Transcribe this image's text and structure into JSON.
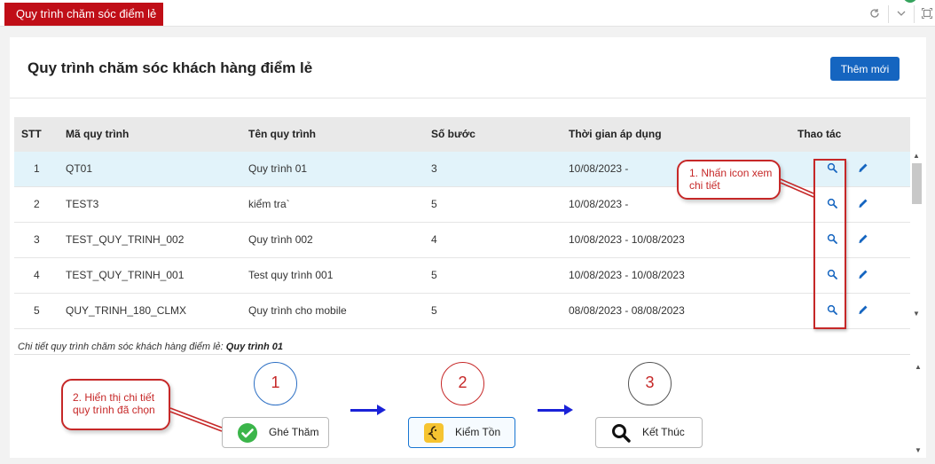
{
  "window": {
    "tab_title": "Quy trình chăm sóc điểm lẻ",
    "controls": [
      "refresh-icon",
      "chevron-down-icon",
      "maximize-icon"
    ]
  },
  "header": {
    "title": "Quy trình chăm sóc khách hàng điểm lẻ",
    "add_button": "Thêm mới"
  },
  "table": {
    "columns": [
      "STT",
      "Mã quy trình",
      "Tên quy trình",
      "Số bước",
      "Thời gian áp dụng",
      "Thao tác"
    ],
    "rows": [
      {
        "stt": "1",
        "ma": "QT01",
        "ten": "Quy trình 01",
        "so_buoc": "3",
        "thoi_gian": "10/08/2023 -",
        "selected": true
      },
      {
        "stt": "2",
        "ma": "TEST3",
        "ten": "kiểm tra`",
        "so_buoc": "5",
        "thoi_gian": "10/08/2023 -",
        "selected": false
      },
      {
        "stt": "3",
        "ma": "TEST_QUY_TRINH_002",
        "ten": "Quy trình 002",
        "so_buoc": "4",
        "thoi_gian": "10/08/2023 - 10/08/2023",
        "selected": false
      },
      {
        "stt": "4",
        "ma": "TEST_QUY_TRINH_001",
        "ten": "Test quy trình 001",
        "so_buoc": "5",
        "thoi_gian": "10/08/2023 - 10/08/2023",
        "selected": false
      },
      {
        "stt": "5",
        "ma": "QUY_TRINH_180_CLMX",
        "ten": "Quy trình cho mobile",
        "so_buoc": "5",
        "thoi_gian": "08/08/2023 - 08/08/2023",
        "selected": false
      }
    ],
    "row_icons": {
      "view": "search-icon",
      "edit": "pencil-icon"
    }
  },
  "annotations": {
    "callout_1": "1. Nhấn icon xem chi tiết",
    "callout_2": "2. Hiển thị chi tiết quy trình đã chọn"
  },
  "detail": {
    "label": "Chi tiết quy trình chăm sóc khách hàng điểm lẻ:",
    "selected_name": "Quy trình 01",
    "steps": [
      {
        "number": "1",
        "label": "Ghé Thăm",
        "icon": "check-circle-icon"
      },
      {
        "number": "2",
        "label": "Kiểm Tồn",
        "icon": "inventory-icon"
      },
      {
        "number": "3",
        "label": "Kết Thúc",
        "icon": "search-icon"
      }
    ]
  },
  "colors": {
    "brand_red": "#c00e17",
    "primary_blue": "#1565c0",
    "annotation_red": "#c62828",
    "arrow_blue": "#1a22d8",
    "selected_row": "#e2f3fa",
    "check_green": "#3bb54a"
  }
}
